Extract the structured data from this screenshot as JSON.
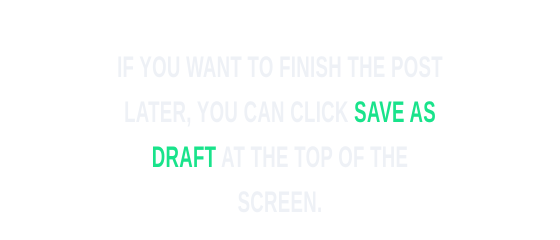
{
  "instruction": {
    "text_before": "If you want to finish the post later, you can click",
    "highlight": "Save as draft",
    "text_after": "at the top of the screen."
  },
  "colors": {
    "text": "#eef1f6",
    "highlight": "#19e38b",
    "background": "#ffffff"
  }
}
